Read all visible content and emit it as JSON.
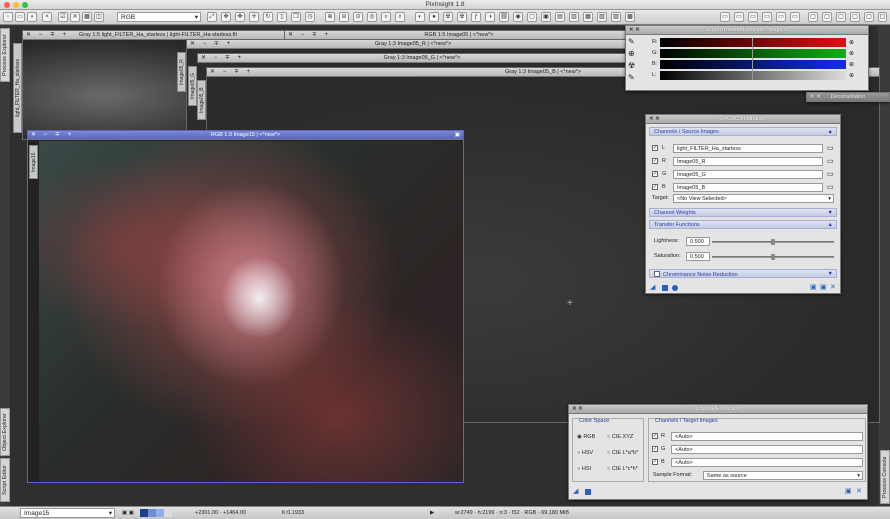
{
  "window": {
    "title": "PixInsight 1.8"
  },
  "toolbar": {
    "view_selector": "RGB"
  },
  "side_tabs": {
    "process_explorer": "Process Explorer",
    "object_explorer": "Object Explorer",
    "script_editor": "Script Editor",
    "process_console": "Process Console"
  },
  "windows": {
    "gray_starless": {
      "title": "Gray 1:5 light_FILTER_Ha_starless | light-FILTER_Ha-starless.fit",
      "tab": "light_FILTER_Ha_starless"
    },
    "rgb_image05": {
      "title": "RGB 1:5 Image05 | <*new*>"
    },
    "gray_r": {
      "title": "Gray 1:3 Image05_R | <*new*>",
      "tab": "Image05_R"
    },
    "gray_g": {
      "title": "Gray 1:3 Image05_G | <*new*>",
      "tab": "Image05_G"
    },
    "gray_b": {
      "title": "Gray 1:3 Image05_B | <*new*>",
      "tab": "Image05_B"
    },
    "rgb_image15": {
      "title": "RGB 1:3 Image15 | <*new*>",
      "tab": "Image15"
    }
  },
  "stf": {
    "title": "ScreenTransferFunction: Image15",
    "channels": [
      "R:",
      "G:",
      "B:",
      "L:"
    ]
  },
  "deconvolution": {
    "title": "Deconvolution"
  },
  "lrgb": {
    "title": "LRGBCombination",
    "section_channels": "Channels / Source Images",
    "rows": [
      {
        "letter": "L",
        "image": "light_FILTER_Ha_starless"
      },
      {
        "letter": "R",
        "image": "Image05_R"
      },
      {
        "letter": "G",
        "image": "Image05_G"
      },
      {
        "letter": "B",
        "image": "Image05_B"
      }
    ],
    "target_label": "Target:",
    "target_value": "<No View Selected>",
    "section_weights": "Channel Weights",
    "section_transfer": "Transfer Functions",
    "lightness_label": "Lightness:",
    "lightness_value": "0.500",
    "lightness_fraction": 0.5,
    "saturation_label": "Saturation:",
    "saturation_value": "0.500",
    "saturation_fraction": 0.5,
    "section_noise": "Chrominance Noise Reduction"
  },
  "channel_extraction": {
    "title": "ChannelExtraction",
    "color_space_label": "Color Space",
    "spaces": [
      "RGB",
      "CIE XYZ",
      "HSV",
      "CIE L*a*b*",
      "HSI",
      "CIE L*c*h*"
    ],
    "selected_space": "RGB",
    "channels_label": "Channels / Target Images",
    "rows": [
      {
        "letter": "R",
        "value": "<Auto>"
      },
      {
        "letter": "G",
        "value": "<Auto>"
      },
      {
        "letter": "B",
        "value": "<Auto>"
      }
    ],
    "sample_format_label": "Sample Format:",
    "sample_format_value": "Same as source"
  },
  "statusbar": {
    "view": "Image15",
    "coords": "+2301.00 · +1464.00",
    "k": "K:0.1933",
    "info": "w:2749 · h:2199 · n:3 · f32 · RGB · 69.180 MiB"
  },
  "colors": {
    "active_title": "#5a66c2",
    "section_text": "#2a3fa0",
    "stf_red": "#e01010",
    "stf_green": "#12b012",
    "stf_blue": "#1030e0"
  }
}
